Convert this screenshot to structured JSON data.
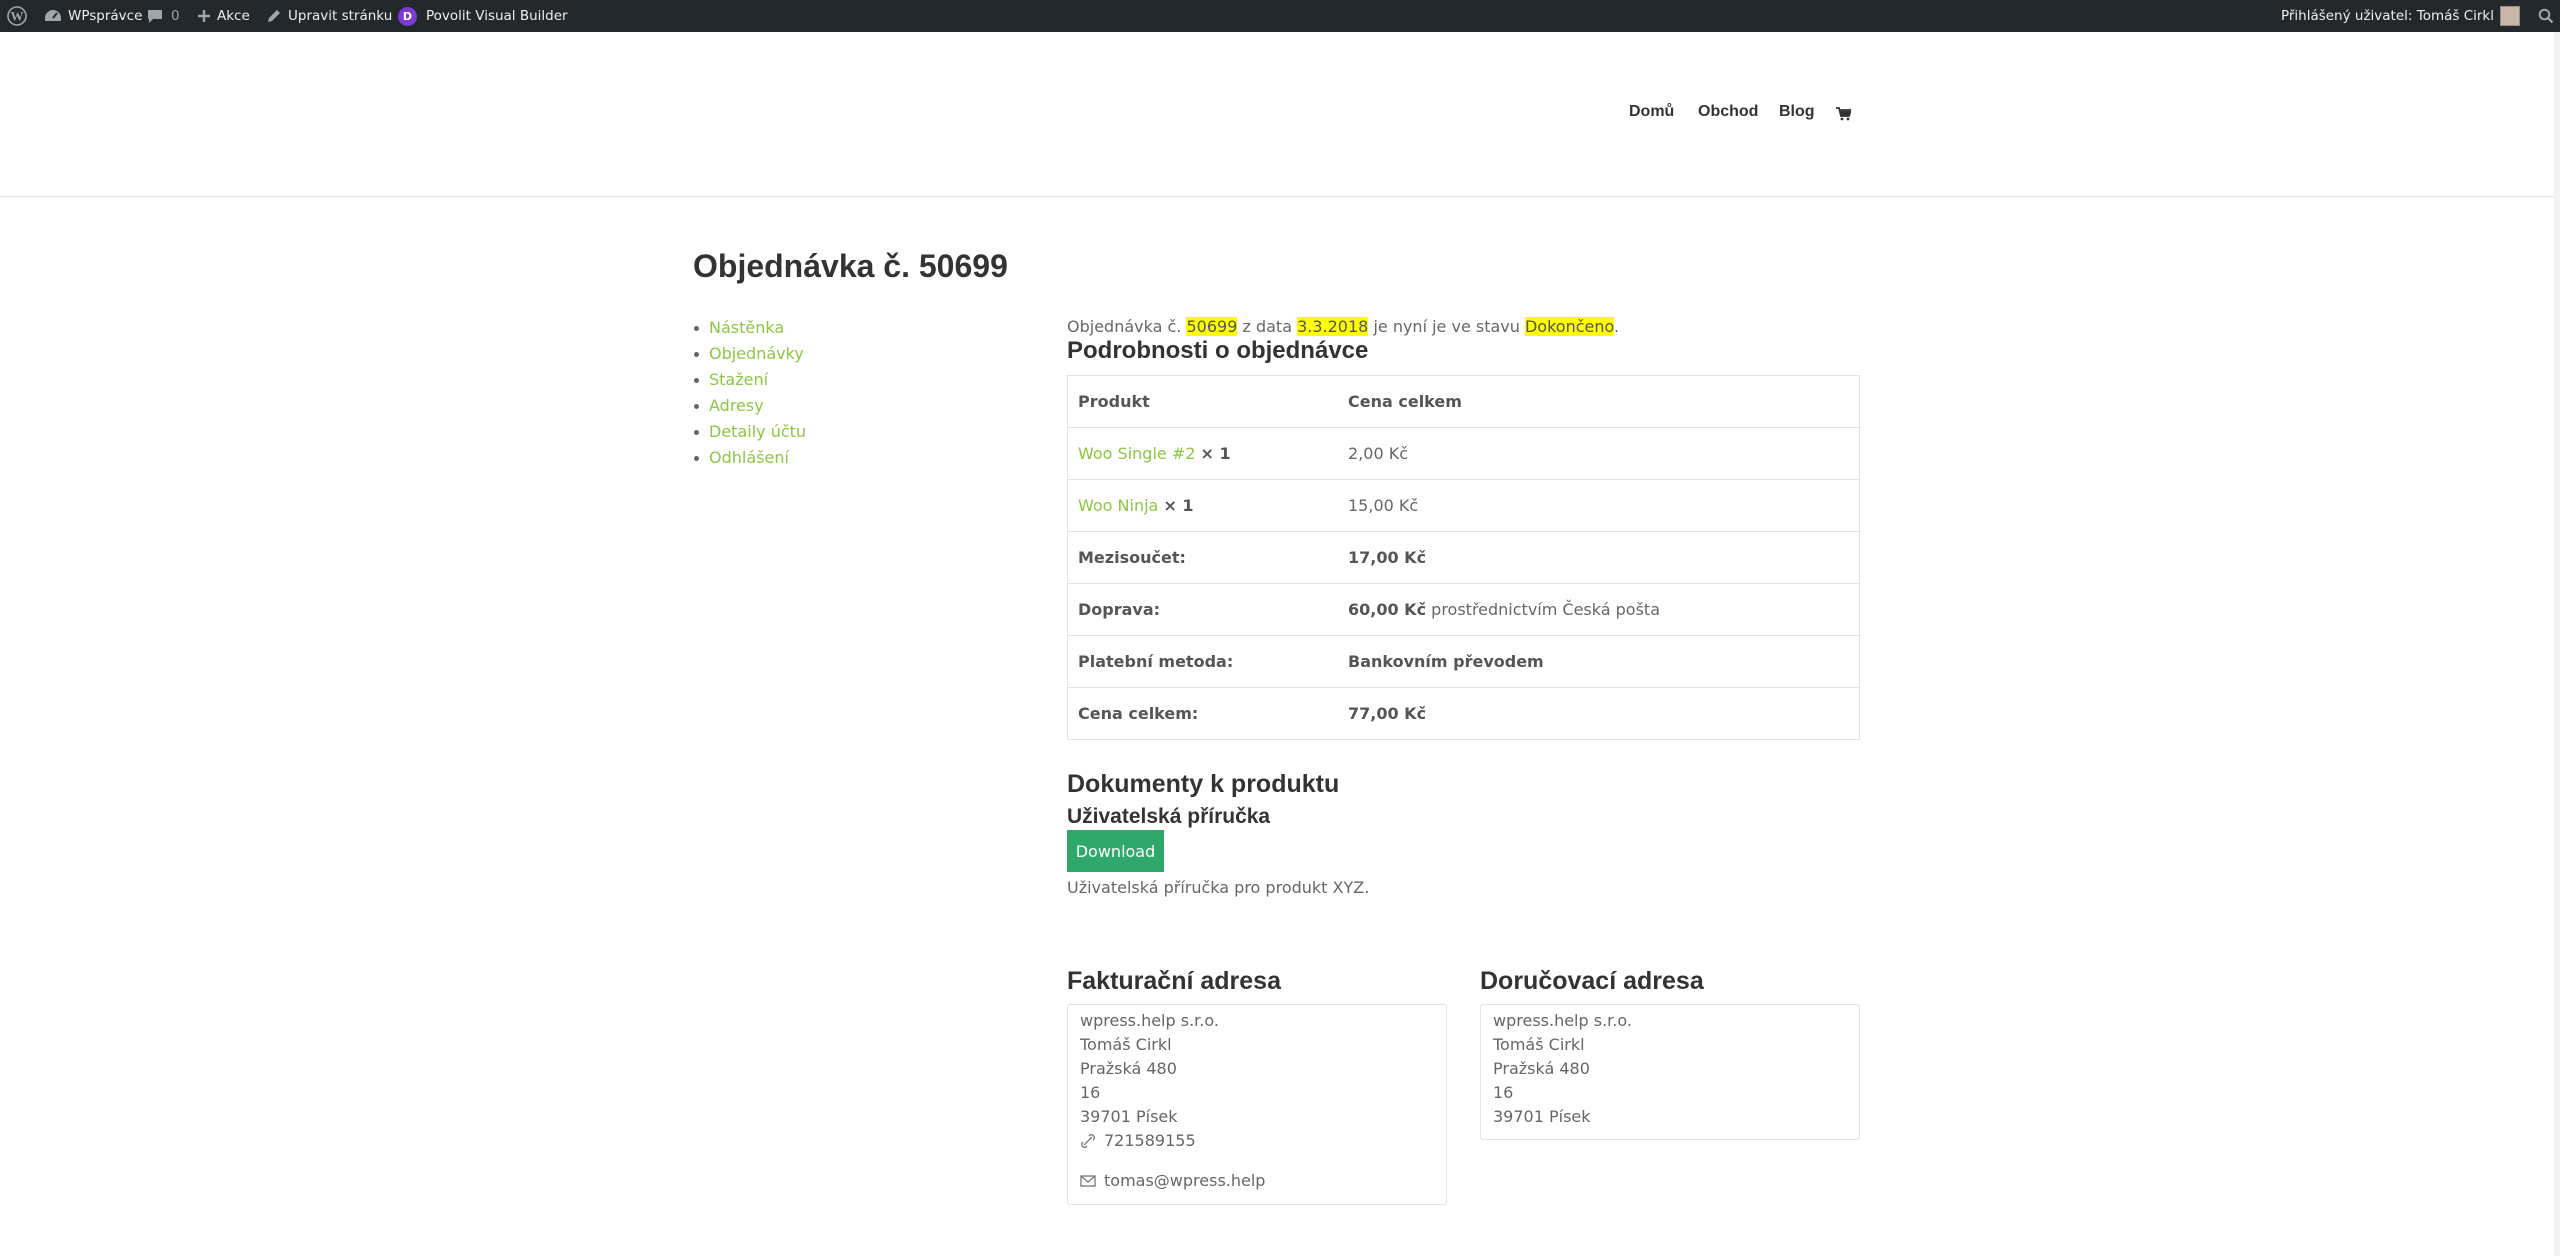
{
  "adminbar": {
    "site_name": "WPsprávce",
    "comments_count": "0",
    "new_label": "Akce",
    "edit_label": "Upravit stránku",
    "builder_badge": "D",
    "builder_label": "Povolit Visual Builder",
    "user_greeting": "Přihlášený uživatel: Tomáš Cirkl"
  },
  "nav": {
    "items": [
      "Domů",
      "Obchod",
      "Blog"
    ]
  },
  "page_title": "Objednávka č. 50699",
  "account_nav": [
    "Nástěnka",
    "Objednávky",
    "Stažení",
    "Adresy",
    "Detaily účtu",
    "Odhlášení"
  ],
  "status": {
    "prefix": "Objednávka č.",
    "order_number": "50699",
    "from_date_text": "z data",
    "date": "3.3.2018",
    "middle": "je nyní je ve stavu",
    "state": "Dokončeno",
    "end": "."
  },
  "order_details": {
    "heading": "Podrobnosti o objednávce",
    "col_product": "Produkt",
    "col_total": "Cena celkem",
    "items": [
      {
        "name": "Woo Single #2",
        "qty": "× 1",
        "price": "2,00 Kč"
      },
      {
        "name": "Woo Ninja",
        "qty": "× 1",
        "price": "15,00 Kč"
      }
    ],
    "subtotal_label": "Mezisoučet:",
    "subtotal_value": "17,00 Kč",
    "shipping_label": "Doprava:",
    "shipping_value": "60,00 Kč",
    "shipping_via": "prostřednictvím Česká pošta",
    "payment_label": "Platební metoda:",
    "payment_value": "Bankovním převodem",
    "total_label": "Cena celkem:",
    "total_value": "77,00 Kč"
  },
  "documents": {
    "heading": "Dokumenty k produktu",
    "doc_title": "Uživatelská příručka",
    "download_label": "Download",
    "description": "Uživatelská příručka pro produkt XYZ."
  },
  "billing": {
    "heading": "Fakturační adresa",
    "lines": [
      "wpress.help s.r.o.",
      "Tomáš Cirkl",
      "Pražská 480",
      "16",
      "39701 Písek"
    ],
    "phone": "721589155",
    "email": "tomas@wpress.help"
  },
  "shipping": {
    "heading": "Doručovací adresa",
    "lines": [
      "wpress.help s.r.o.",
      "Tomáš Cirkl",
      "Pražská 480",
      "16",
      "39701 Písek"
    ]
  },
  "colors": {
    "link": "#8dc63f",
    "highlight": "#ffff00",
    "button": "#2ea86b",
    "adminbar": "#23282d"
  }
}
